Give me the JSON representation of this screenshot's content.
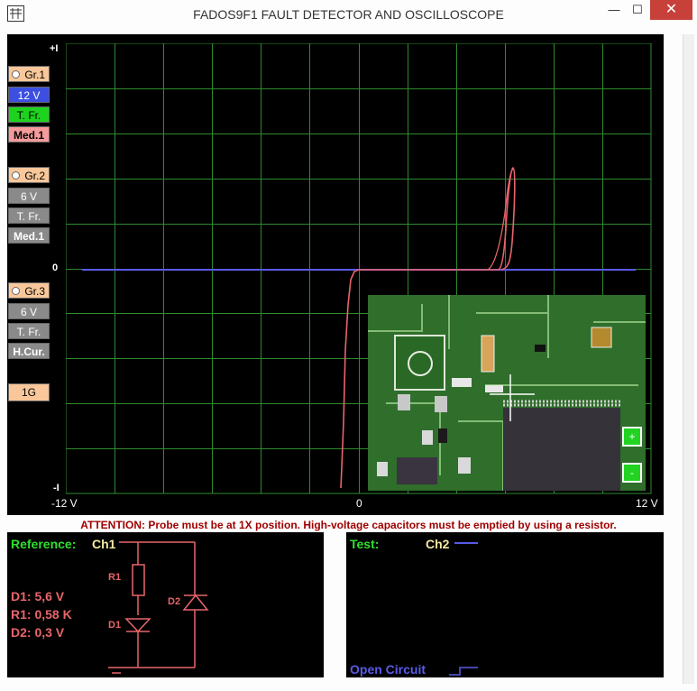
{
  "window": {
    "title": "FADOS9F1   FAULT DETECTOR AND OSCILLOSCOPE",
    "minimize": "—",
    "maximize": "☐",
    "close": "✕"
  },
  "plot": {
    "y_top": "+I",
    "y_zero": "0",
    "y_bottom": "-I",
    "x_left": "-12 V",
    "x_zero": "0",
    "x_right": "12 V",
    "colors": {
      "grid": "#2e8b2e",
      "ch1": "#e8656b",
      "ch2": "#5a5ae8"
    }
  },
  "controls": {
    "gr1": {
      "label": "Gr.1",
      "voltage": "12 V",
      "tfr": "T. Fr.",
      "med": "Med.1"
    },
    "gr2": {
      "label": "Gr.2",
      "voltage": "6 V",
      "tfr": "T. Fr.",
      "med": "Med.1"
    },
    "gr3": {
      "label": "Gr.3",
      "voltage": "6 V",
      "tfr": "T. Fr.",
      "cur": "H.Cur."
    },
    "freq": "1G"
  },
  "side_buttons": {
    "plus": "+",
    "minus": "-"
  },
  "attention": "ATTENTION: Probe must be at 1X position. High-voltage capacitors must be emptied by using a resistor.",
  "reference": {
    "label": "Reference:",
    "channel": "Ch1",
    "r1_label": "R1",
    "d1_label": "D1",
    "d2_label": "D2",
    "d1_value": "D1: 5,6 V",
    "r1_value": "R1: 0,58 K",
    "d2_value": "D2: 0,3 V"
  },
  "test": {
    "label": "Test:",
    "channel": "Ch2",
    "status": "Open Circuit"
  },
  "pcb_labels": [
    "12",
    "10",
    "B1",
    "R38",
    "R35",
    "Idd",
    "JP1",
    "C22",
    "ST",
    "User",
    "C33",
    "R34",
    "R32",
    "C31",
    "C32",
    "D2",
    "C34",
    "C41",
    "LD",
    "R39",
    "R40",
    "C42",
    "R36",
    "C38",
    "ARM",
    "U4"
  ]
}
